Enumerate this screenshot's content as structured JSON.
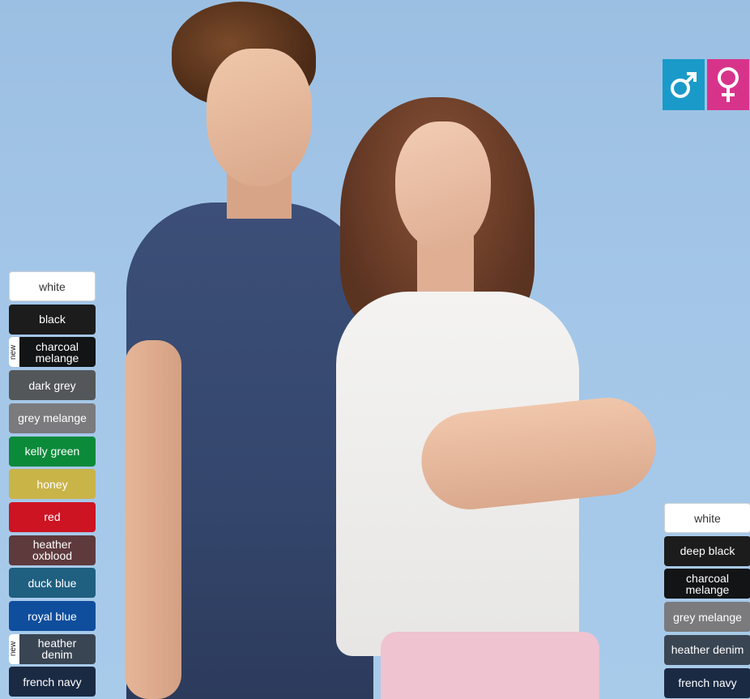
{
  "gender_icons": {
    "male": {
      "icon": "male-symbol-icon",
      "color": "#1a9ac9"
    },
    "female": {
      "icon": "female-symbol-icon",
      "color": "#d8338b"
    }
  },
  "men_colors": [
    {
      "label": "white",
      "color": "#ffffff",
      "new": false
    },
    {
      "label": "black",
      "color": "#1c1c1c",
      "new": false
    },
    {
      "label": "charcoal melange",
      "color": "#121416",
      "new": true
    },
    {
      "label": "dark grey",
      "color": "#545759",
      "new": false
    },
    {
      "label": "grey melange",
      "color": "#7b7a7d",
      "new": false
    },
    {
      "label": "kelly green",
      "color": "#0b8a3a",
      "new": false
    },
    {
      "label": "honey",
      "color": "#c9b448",
      "new": false
    },
    {
      "label": "red",
      "color": "#cc1423",
      "new": false
    },
    {
      "label": "heather oxblood",
      "color": "#5e3a3d",
      "new": false
    },
    {
      "label": "duck blue",
      "color": "#1f5f80",
      "new": false
    },
    {
      "label": "royal blue",
      "color": "#0f4e9d",
      "new": false
    },
    {
      "label": "heather denim",
      "color": "#3a4553",
      "new": true
    },
    {
      "label": "french navy",
      "color": "#1a2a43",
      "new": false
    }
  ],
  "women_colors": [
    {
      "label": "white",
      "color": "#ffffff",
      "new": false
    },
    {
      "label": "deep black",
      "color": "#1c1c1c",
      "new": false
    },
    {
      "label": "charcoal melange",
      "color": "#121416",
      "new": false
    },
    {
      "label": "grey melange",
      "color": "#7b7a7d",
      "new": false
    },
    {
      "label": "heather denim",
      "color": "#3a4553",
      "new": false
    },
    {
      "label": "french navy",
      "color": "#1a2a43",
      "new": false
    }
  ],
  "new_badge_label": "new"
}
